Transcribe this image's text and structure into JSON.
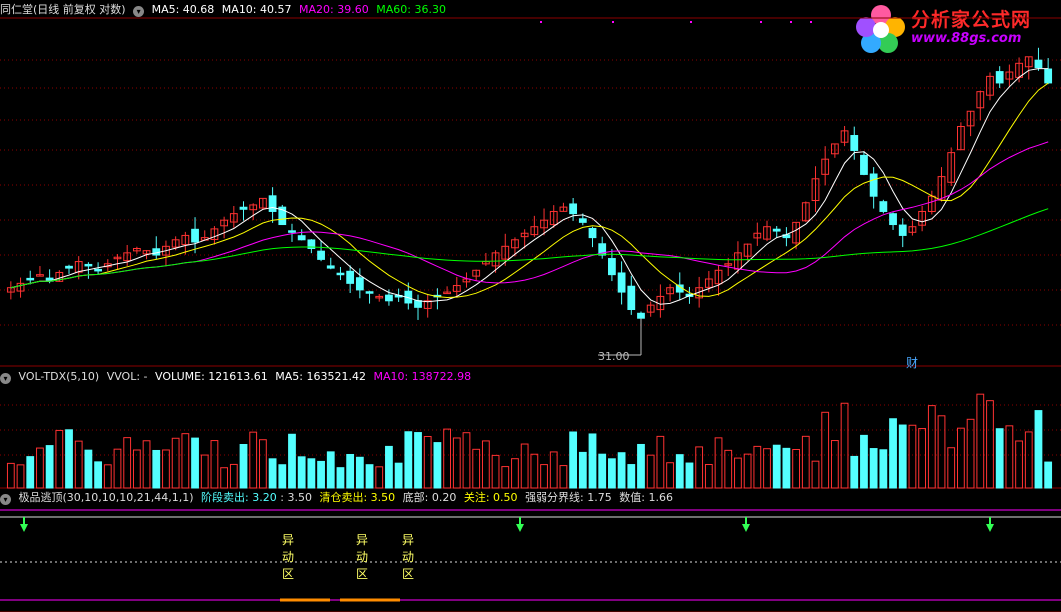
{
  "main": {
    "title": "同仁堂(日线 前复权 对数)",
    "ma5": "MA5: 40.68",
    "ma10": "MA10: 40.57",
    "ma20": "MA20: 39.60",
    "ma60": "MA60: 36.30",
    "low_label": "31.00",
    "fin_marker": "财"
  },
  "vol": {
    "title": "VOL-TDX(5,10)",
    "vvol": "VVOL: -",
    "volume": "VOLUME: 121613.61",
    "ma5": "MA5: 163521.42",
    "ma10": "MA10: 138722.98"
  },
  "ind": {
    "title": "极品逃顶(30,10,10,10,21,44,1,1)",
    "stage_sell": "阶段卖出: 3.20",
    "stage_sell2": ": 3.50",
    "clear_sell": "清仓卖出: 3.50",
    "bottom": "底部: 0.20",
    "watch": "关注: 0.50",
    "strong_weak": "强弱分界线: 1.75",
    "value": "数值: 1.66",
    "anomaly_labels": [
      "异",
      "动",
      "区"
    ]
  },
  "logo": {
    "name": "分析家公式网",
    "url": "www.88gs.com"
  },
  "colors": {
    "up": "#ff3232",
    "down": "#54ffff",
    "ma5": "#ffffff",
    "ma10": "#ffff00",
    "ma20": "#ff00ff",
    "ma60": "#00ff00",
    "grid": "#8b0000"
  },
  "chart_data": [
    {
      "type": "candlestick",
      "title": "同仁堂(日线 前复权 对数)",
      "ylim": [
        31,
        45
      ],
      "annotations": [
        "31.00",
        "财"
      ],
      "series": [
        {
          "name": "MA5",
          "last": 40.68
        },
        {
          "name": "MA10",
          "last": 40.57
        },
        {
          "name": "MA20",
          "last": 39.6
        },
        {
          "name": "MA60",
          "last": 36.3
        }
      ],
      "close": [
        33.4,
        33.6,
        33.8,
        34.0,
        33.7,
        34.1,
        34.3,
        34.6,
        34.4,
        34.2,
        34.5,
        34.8,
        35.0,
        35.2,
        35.1,
        34.9,
        35.3,
        35.6,
        35.8,
        35.5,
        35.7,
        36.1,
        36.5,
        36.8,
        37.0,
        37.2,
        37.5,
        36.9,
        36.3,
        36.0,
        35.6,
        35.2,
        34.7,
        34.3,
        34.0,
        33.6,
        33.3,
        33.2,
        33.0,
        32.8,
        33.0,
        32.7,
        32.5,
        32.8,
        33.0,
        33.2,
        33.5,
        33.8,
        34.2,
        34.6,
        35.0,
        35.3,
        35.6,
        35.9,
        36.2,
        36.5,
        36.9,
        37.1,
        36.8,
        36.4,
        35.7,
        34.9,
        34.0,
        33.2,
        32.4,
        32.0,
        32.6,
        33.0,
        33.4,
        33.2,
        33.0,
        33.4,
        33.8,
        34.2,
        34.5,
        35.0,
        35.4,
        35.9,
        36.2,
        36.0,
        35.7,
        36.4,
        37.3,
        38.4,
        39.3,
        40.0,
        40.6,
        39.7,
        38.6,
        37.6,
        36.9,
        36.3,
        35.8,
        36.2,
        36.9,
        37.6,
        38.5,
        39.6,
        40.8,
        41.5,
        42.4,
        43.1,
        42.8,
        43.3,
        43.7,
        44.0,
        43.5,
        42.8
      ],
      "volume_series": [
        {
          "name": "VOLUME",
          "last": 121613.61
        },
        {
          "name": "MA5",
          "last": 163521.42
        },
        {
          "name": "MA10",
          "last": 138722.98
        }
      ],
      "indicator_series": [
        {
          "name": "阶段卖出",
          "values": [
            3.2,
            3.5
          ]
        },
        {
          "name": "清仓卖出",
          "value": 3.5
        },
        {
          "name": "底部",
          "value": 0.2
        },
        {
          "name": "关注",
          "value": 0.5
        },
        {
          "name": "强弱分界线",
          "value": 1.75
        },
        {
          "name": "数值",
          "value": 1.66
        }
      ]
    }
  ]
}
